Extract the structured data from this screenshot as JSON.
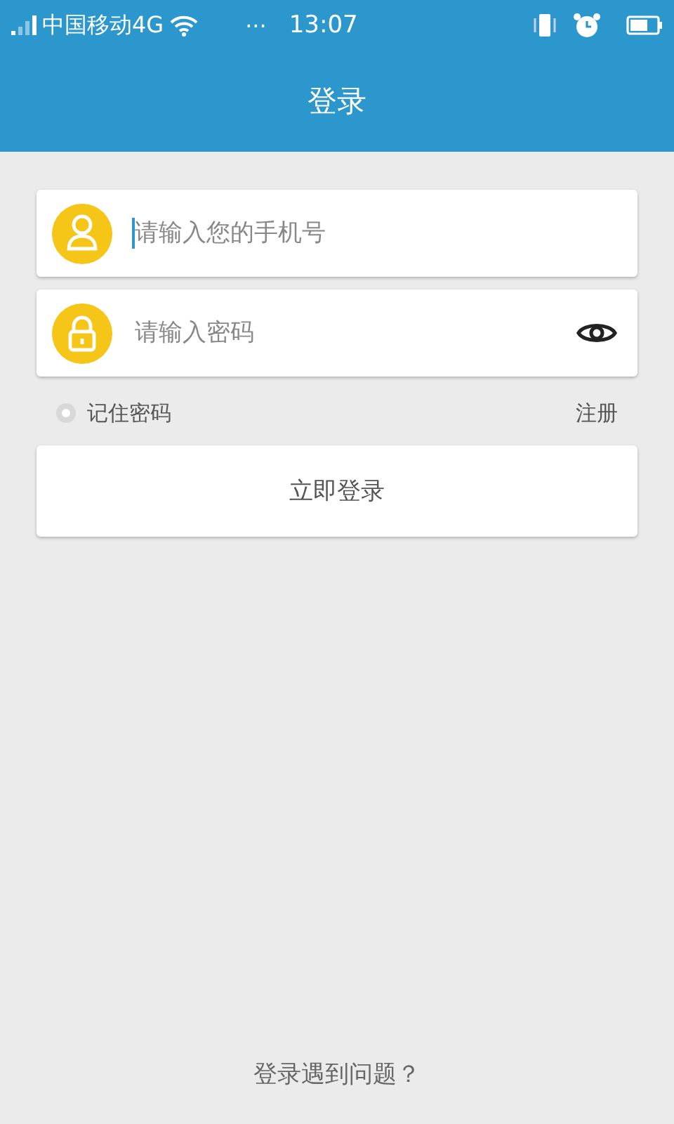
{
  "status_bar": {
    "carrier": "中国移动4G",
    "dots": "···",
    "time": "13:07"
  },
  "header": {
    "title": "登录"
  },
  "fields": [
    {
      "kind": "phone",
      "placeholder": "请输入您的手机号",
      "focused": true
    },
    {
      "kind": "password",
      "placeholder": "请输入密码",
      "focused": false
    }
  ],
  "remember": {
    "label": "记住密码",
    "checked": false
  },
  "register_link": "注册",
  "login_button": "立即登录",
  "help_link": "登录遇到问题？"
}
